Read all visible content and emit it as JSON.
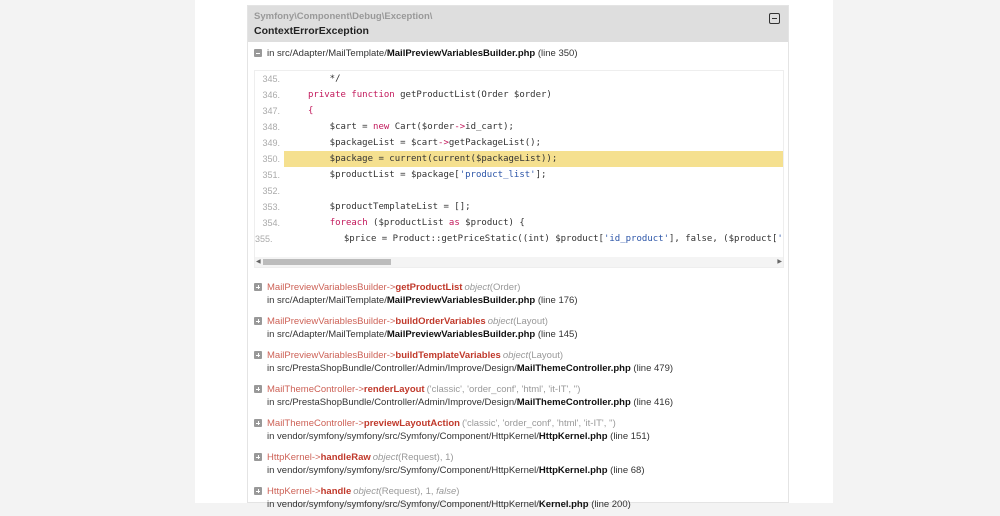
{
  "exception": {
    "namespace": "Symfony\\Component\\Debug\\Exception\\",
    "class": "ContextErrorException"
  },
  "location": {
    "prefix": "in src/Adapter/MailTemplate/",
    "file": "MailPreviewVariablesBuilder.php",
    "line": "(line 350)"
  },
  "code": [
    {
      "no": "345.",
      "tokens": [
        [
          "    */",
          ""
        ]
      ]
    },
    {
      "no": "346.",
      "tokens": [
        [
          "private function",
          "kw"
        ],
        [
          " getProductList(Order $order)",
          ""
        ]
      ]
    },
    {
      "no": "347.",
      "tokens": [
        [
          "{",
          "kw"
        ]
      ]
    },
    {
      "no": "348.",
      "tokens": [
        [
          "    $cart = ",
          ""
        ],
        [
          "new",
          "kw"
        ],
        [
          " Cart($order",
          ""
        ],
        [
          "->",
          "kw"
        ],
        [
          "id_cart);",
          ""
        ]
      ]
    },
    {
      "no": "349.",
      "tokens": [
        [
          "    $packageList = $cart",
          ""
        ],
        [
          "->",
          "kw"
        ],
        [
          "getPackageList();",
          ""
        ]
      ]
    },
    {
      "no": "350.",
      "highlight": true,
      "tokens": [
        [
          "    $package = current(current($packageList));",
          ""
        ]
      ]
    },
    {
      "no": "351.",
      "tokens": [
        [
          "    $productList = $package[",
          ""
        ],
        [
          "'product_list'",
          "st"
        ],
        [
          "];",
          ""
        ]
      ]
    },
    {
      "no": "352.",
      "tokens": []
    },
    {
      "no": "353.",
      "tokens": [
        [
          "    $productTemplateList = [];",
          ""
        ]
      ]
    },
    {
      "no": "354.",
      "tokens": [
        [
          "    ",
          ""
        ],
        [
          "foreach",
          "kw"
        ],
        [
          " ($productList ",
          ""
        ],
        [
          "as",
          "kw"
        ],
        [
          " $product) {",
          ""
        ]
      ]
    },
    {
      "no": "355.",
      "tokens": [
        [
          "        $price = Product::getPriceStatic((int) $product[",
          ""
        ],
        [
          "'id_product'",
          "st"
        ],
        [
          "], false, ($product[",
          ""
        ],
        [
          "'id_produ",
          "st"
        ]
      ]
    }
  ],
  "trace": [
    {
      "class": "MailPreviewVariablesBuilder",
      "method": "getProductList",
      "args": [
        [
          "object",
          true
        ],
        [
          "(Order)",
          false
        ]
      ],
      "path": "in src/Adapter/MailTemplate/",
      "file": "MailPreviewVariablesBuilder.php",
      "line": "(line 176)"
    },
    {
      "class": "MailPreviewVariablesBuilder",
      "method": "buildOrderVariables",
      "args": [
        [
          "object",
          true
        ],
        [
          "(Layout)",
          false
        ]
      ],
      "path": "in src/Adapter/MailTemplate/",
      "file": "MailPreviewVariablesBuilder.php",
      "line": "(line 145)"
    },
    {
      "class": "MailPreviewVariablesBuilder",
      "method": "buildTemplateVariables",
      "args": [
        [
          "object",
          true
        ],
        [
          "(Layout)",
          false
        ]
      ],
      "path": "in src/PrestaShopBundle/Controller/Admin/Improve/Design/",
      "file": "MailThemeController.php",
      "line": "(line 479)"
    },
    {
      "class": "MailThemeController",
      "method": "renderLayout",
      "args": [
        [
          "('classic', 'order_conf', 'html', 'it-IT', '')",
          false
        ]
      ],
      "path": "in src/PrestaShopBundle/Controller/Admin/Improve/Design/",
      "file": "MailThemeController.php",
      "line": "(line 416)"
    },
    {
      "class": "MailThemeController",
      "method": "previewLayoutAction",
      "args": [
        [
          "('classic', 'order_conf', 'html', 'it-IT', '')",
          false
        ]
      ],
      "path": "in vendor/symfony/symfony/src/Symfony/Component/HttpKernel/",
      "file": "HttpKernel.php",
      "line": "(line 151)"
    },
    {
      "class": "HttpKernel",
      "method": "handleRaw",
      "args": [
        [
          "object",
          true
        ],
        [
          "(Request), 1)",
          false
        ]
      ],
      "path": "in vendor/symfony/symfony/src/Symfony/Component/HttpKernel/",
      "file": "HttpKernel.php",
      "line": "(line 68)"
    },
    {
      "class": "HttpKernel",
      "method": "handle",
      "args": [
        [
          "object",
          true
        ],
        [
          "(Request), 1, ",
          false
        ],
        [
          "false",
          true
        ],
        [
          ")",
          false
        ]
      ],
      "path": "in vendor/symfony/symfony/src/Symfony/Component/HttpKernel/",
      "file": "Kernel.php",
      "line": "(line 200)"
    }
  ],
  "arrow": " -> "
}
